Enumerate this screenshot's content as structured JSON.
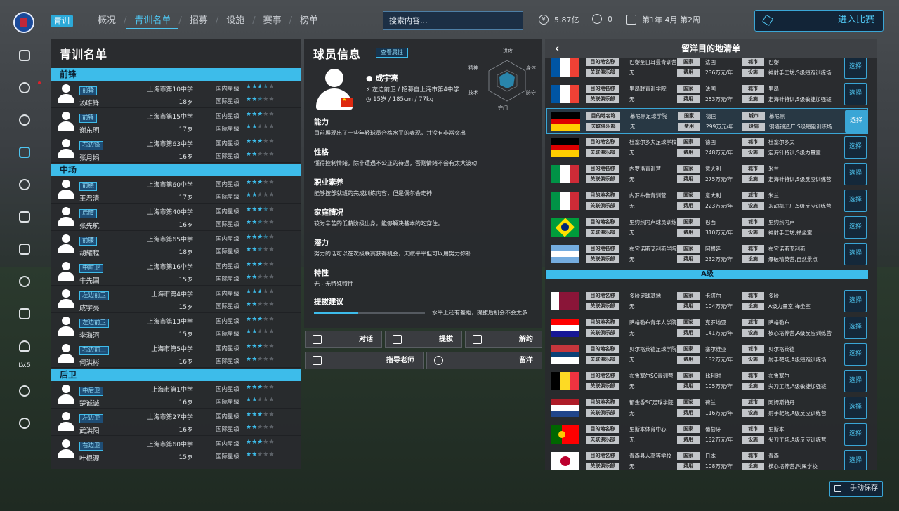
{
  "nav": {
    "tag": "青训",
    "items": [
      "概况",
      "青训名单",
      "招募",
      "设施",
      "赛事",
      "榜单"
    ],
    "active": 1,
    "search_placeholder": "搜索内容...",
    "money": "5.87亿",
    "count": "0",
    "date": "第1年 4月 第2周",
    "enter_match": "进入比赛"
  },
  "sidebar": {
    "level": "LV.5"
  },
  "roster": {
    "title": "青训名单",
    "groups": [
      {
        "name": "前锋",
        "players": [
          {
            "pos": "前锋",
            "name": "汤唯锋",
            "school": "上海市第10中学",
            "age": "18岁",
            "lvl1": "国内星级",
            "lvl2": "国际星级",
            "s1": 3.5,
            "s2": 2.5
          },
          {
            "pos": "前锋",
            "name": "谢东明",
            "school": "上海市第15中学",
            "age": "17岁",
            "lvl1": "国内星级",
            "lvl2": "国际星级",
            "s1": 3,
            "s2": 2
          },
          {
            "pos": "右边锋",
            "name": "张月娟",
            "school": "上海市第63中学",
            "age": "16岁",
            "lvl1": "国内星级",
            "lvl2": "国际星级",
            "s1": 3,
            "s2": 2
          }
        ]
      },
      {
        "name": "中场",
        "players": [
          {
            "pos": "前腰",
            "name": "王君清",
            "school": "上海市第60中学",
            "age": "17岁",
            "lvl1": "国内星级",
            "lvl2": "国际星级",
            "s1": 3,
            "s2": 2
          },
          {
            "pos": "后腰",
            "name": "张先航",
            "school": "上海市第40中学",
            "age": "16岁",
            "lvl1": "国内星级",
            "lvl2": "国际星级",
            "s1": 3.5,
            "s2": 2.5
          },
          {
            "pos": "前腰",
            "name": "胡耀程",
            "school": "上海市第65中学",
            "age": "18岁",
            "lvl1": "国内星级",
            "lvl2": "国际星级",
            "s1": 3.5,
            "s2": 2.5
          },
          {
            "pos": "中前卫",
            "name": "牛先国",
            "school": "上海市第16中学",
            "age": "15岁",
            "lvl1": "国内星级",
            "lvl2": "国际星级",
            "s1": 3,
            "s2": 2
          },
          {
            "pos": "左边前卫",
            "name": "成宇亮",
            "school": "上海市第4中学",
            "age": "15岁",
            "lvl1": "国内星级",
            "lvl2": "国际星级",
            "s1": 3,
            "s2": 2
          },
          {
            "pos": "左边前卫",
            "name": "李海河",
            "school": "上海市第13中学",
            "age": "15岁",
            "lvl1": "国内星级",
            "lvl2": "国际星级",
            "s1": 3,
            "s2": 2
          },
          {
            "pos": "右边前卫",
            "name": "何洪彬",
            "school": "上海市第5中学",
            "age": "16岁",
            "lvl1": "国内星级",
            "lvl2": "国际星级",
            "s1": 3,
            "s2": 2
          }
        ]
      },
      {
        "name": "后卫",
        "players": [
          {
            "pos": "中后卫",
            "name": "楚诚诚",
            "school": "上海市第1中学",
            "age": "16岁",
            "lvl1": "国内星级",
            "lvl2": "国际星级",
            "s1": 3,
            "s2": 2
          },
          {
            "pos": "左边卫",
            "name": "武洪阳",
            "school": "上海市第27中学",
            "age": "16岁",
            "lvl1": "国内星级",
            "lvl2": "国际星级",
            "s1": 3,
            "s2": 2
          },
          {
            "pos": "右边卫",
            "name": "叶根源",
            "school": "上海市第60中学",
            "age": "15岁",
            "lvl1": "国内星级",
            "lvl2": "国际星级",
            "s1": 3,
            "s2": 2
          }
        ]
      }
    ]
  },
  "player": {
    "title": "球员信息",
    "attr_button": "查看属性",
    "name": "成宇亮",
    "position_line": "左边前卫 / 招募自上海市第4中学",
    "age_line": "15岁 / 185cm / 77kg",
    "radar_labels": [
      "进攻",
      "身体",
      "防守",
      "守门",
      "技术",
      "精神"
    ],
    "sections": [
      {
        "title": "能力",
        "text": "目前展现出了一些年轻球员合格水平的表现，并没有非常突出"
      },
      {
        "title": "性格",
        "text": "懂得控制情绪，除非遭遇不公正的待遇，否则情绪不会有太大波动"
      },
      {
        "title": "职业素养",
        "text": "能够按部就班的完成训练内容，但是偶尔会走神"
      },
      {
        "title": "家庭情况",
        "text": "较为辛苦的低薪阶级出身，能够解决基本的吃穿住。"
      },
      {
        "title": "潜力",
        "text": "努力的话可以在次级联赛获得机会，天赋平平但可以用努力弥补"
      },
      {
        "title": "特性",
        "text": "无 - 无特殊特性"
      }
    ],
    "promote_title": "提拔建议",
    "promote_value": 0.4,
    "promote_text": "水平上还有差距，提拔后机会不会太多"
  },
  "actions": [
    "对话",
    "提拔",
    "解约",
    "指导老师",
    "留洋"
  ],
  "destinations": {
    "title": "留洋目的地清单",
    "lab_target": "目的地名称",
    "lab_club": "关联俱乐部",
    "lab_country": "国家",
    "lab_fee": "费用",
    "lab_city": "城市",
    "lab_facility": "设施",
    "select_label": "选择",
    "tier_label": "A级",
    "rows": [
      {
        "flag": "fr",
        "target": "巴黎圣日耳曼青训营",
        "club": "无",
        "country": "法国",
        "fee": "236万元/年",
        "city": "巴黎",
        "facility": "神射手工坊,S级短跑训练场"
      },
      {
        "flag": "fr",
        "target": "里昂联青训学院",
        "club": "无",
        "country": "法国",
        "fee": "253万元/年",
        "city": "里昂",
        "facility": "定海针特训,S级敏捷加强班"
      },
      {
        "flag": "de",
        "target": "慕尼黑足球学院",
        "club": "无",
        "country": "德国",
        "fee": "299万元/年",
        "city": "慕尼黑",
        "facility": "钢墙锻造厂,S级短跑训练场",
        "sel": true
      },
      {
        "flag": "de",
        "target": "杜塞尔多夫足球学校",
        "club": "无",
        "country": "德国",
        "fee": "248万元/年",
        "city": "杜塞尔多夫",
        "facility": "定海针特训,S级力量室"
      },
      {
        "flag": "it",
        "target": "内罗洛青训营",
        "club": "无",
        "country": "意大利",
        "fee": "275万元/年",
        "city": "米兰",
        "facility": "定海针特训,S级反应训练营"
      },
      {
        "flag": "it",
        "target": "内罗布鲁青训营",
        "club": "无",
        "country": "意大利",
        "fee": "223万元/年",
        "city": "米兰",
        "facility": "永动机工厂,S级反应训练营"
      },
      {
        "flag": "br",
        "target": "里约热内卢球员训练中心",
        "club": "无",
        "country": "巴西",
        "fee": "310万元/年",
        "city": "里约热内卢",
        "facility": "神射手工坊,禅坐室"
      },
      {
        "flag": "ar",
        "target": "布宜诺斯艾利斯学院",
        "club": "无",
        "country": "阿根廷",
        "fee": "232万元/年",
        "city": "布宜诺斯艾利斯",
        "facility": "爆破精英营,自然景点"
      },
      {
        "flag": "qa",
        "target": "多哈足球基地",
        "club": "无",
        "country": "卡塔尔",
        "fee": "104万元/年",
        "city": "多哈",
        "facility": "A级力量室,禅坐室"
      },
      {
        "flag": "hr",
        "target": "萨格勒布青年人学院",
        "club": "无",
        "country": "克罗地亚",
        "fee": "141万元/年",
        "city": "萨格勒布",
        "facility": "核心培养营,A级反应训练营"
      },
      {
        "flag": "rs",
        "target": "贝尔格莱德足球学院",
        "club": "无",
        "country": "塞尔维亚",
        "fee": "132万元/年",
        "city": "贝尔格莱德",
        "facility": "射手靶场,A级短跑训练场"
      },
      {
        "flag": "be",
        "target": "布鲁塞尔SC青训营",
        "club": "无",
        "country": "比利时",
        "fee": "105万元/年",
        "city": "布鲁塞尔",
        "facility": "尖刀工场,A级敏捷加强班"
      },
      {
        "flag": "nl",
        "target": "郁金香SC足球学院",
        "club": "无",
        "country": "荷兰",
        "fee": "116万元/年",
        "city": "阿姆斯特丹",
        "facility": "射手靶场,A级反应训练营"
      },
      {
        "flag": "pt",
        "target": "里斯本体育中心",
        "club": "无",
        "country": "葡萄牙",
        "fee": "132万元/年",
        "city": "里斯本",
        "facility": "尖刀工场,A级反应训练营"
      },
      {
        "flag": "jp",
        "target": "青森县人高等学校",
        "club": "无",
        "country": "日本",
        "fee": "108万元/年",
        "city": "青森",
        "facility": "核心培养营,附属学校"
      }
    ]
  },
  "save_label": "手动保存"
}
